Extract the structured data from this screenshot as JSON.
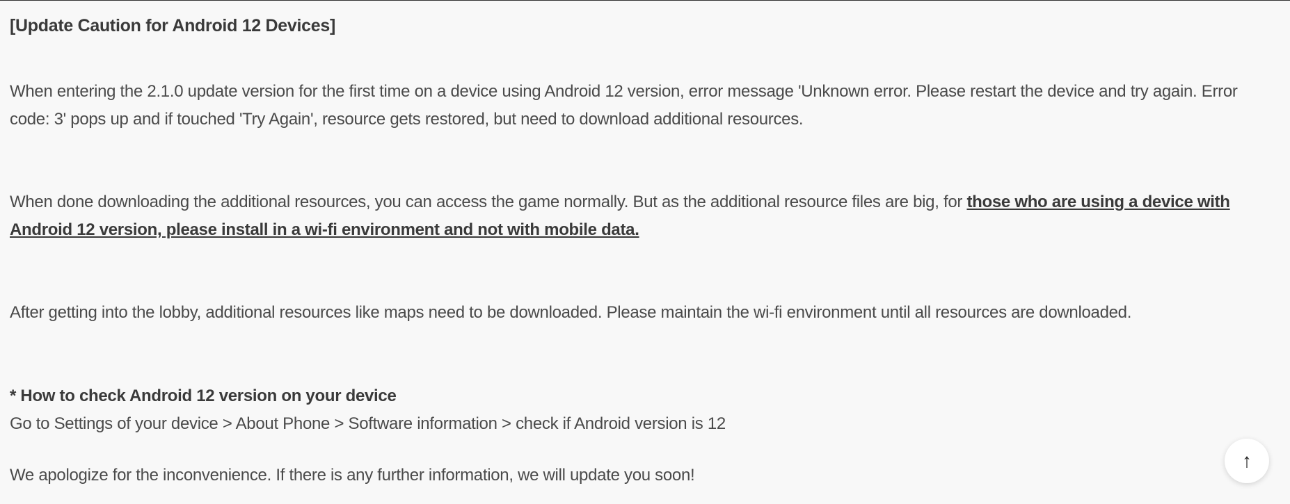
{
  "heading": "[Update Caution for Android 12 Devices]",
  "para1": "When entering the 2.1.0 update version for the first time on a device using Android 12 version, error message 'Unknown error. Please restart the device and try again. Error code: 3' pops up and if touched 'Try Again', resource gets restored, but need to download additional resources.",
  "para2_part1": "When done downloading the additional resources, you can access the game normally. But as the additional resource files are big, for ",
  "para2_bold": "those who are using a device with Android 12 version, please install in a wi-fi environment and not with mobile data.",
  "para3": "After getting into the lobby, additional resources like maps need to be downloaded. Please maintain the wi-fi environment until all resources are downloaded.",
  "howto_heading": "* How to check Android 12 version on your device",
  "howto_steps": "Go to Settings of your device > About Phone > Software information > check if Android version is 12",
  "apology": "We apologize for the inconvenience. If there is any further information, we will update you soon!",
  "scroll_top_label": "↑"
}
